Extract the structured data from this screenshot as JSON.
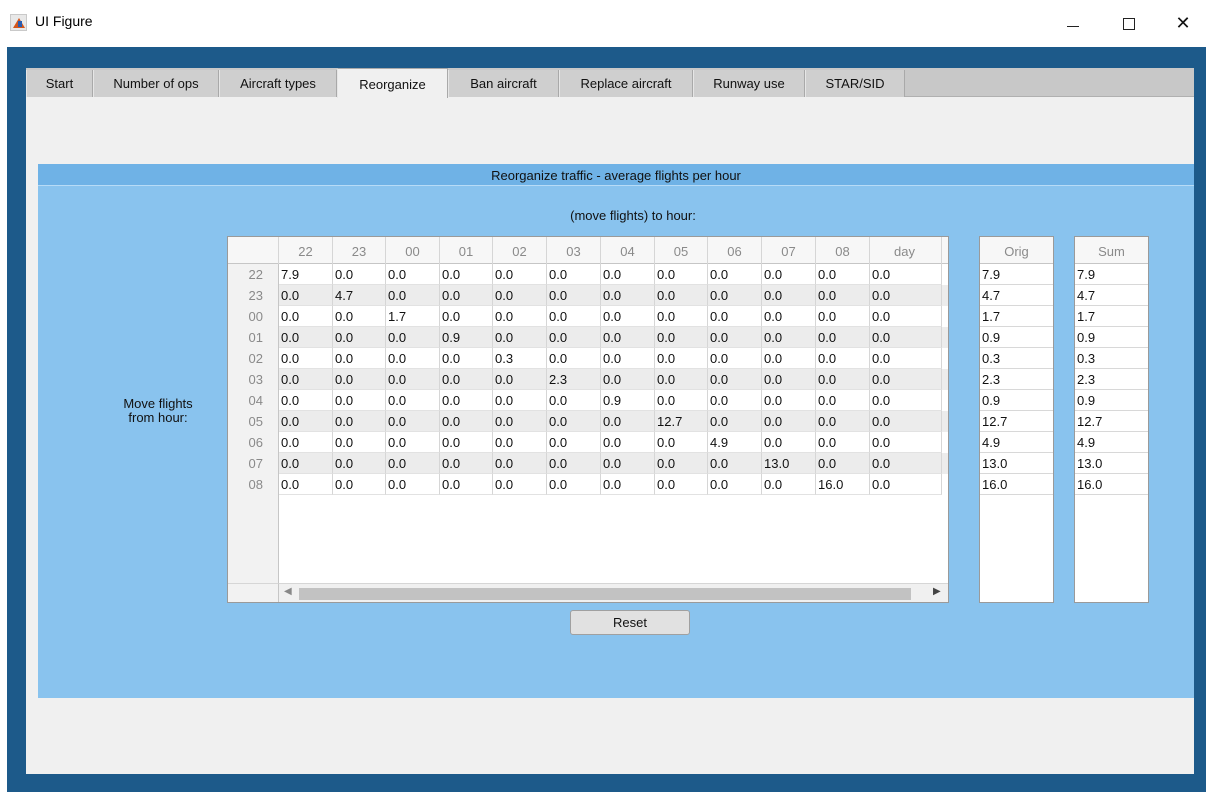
{
  "window": {
    "title": "UI Figure",
    "minimize_symbol": "—",
    "close_symbol": "✕"
  },
  "tabs": [
    {
      "label": "Start"
    },
    {
      "label": "Number of ops"
    },
    {
      "label": "Aircraft types"
    },
    {
      "label": "Reorganize",
      "active": true
    },
    {
      "label": "Ban aircraft"
    },
    {
      "label": "Replace aircraft"
    },
    {
      "label": "Runway use"
    },
    {
      "label": "STAR/SID"
    }
  ],
  "panel": {
    "title": "Reorganize traffic - average flights per hour",
    "subtitle": "(move flights) to hour:",
    "side_label_line1": "Move flights",
    "side_label_line2": "from hour:"
  },
  "table": {
    "columns": [
      "22",
      "23",
      "00",
      "01",
      "02",
      "03",
      "04",
      "05",
      "06",
      "07",
      "08",
      "day"
    ],
    "rows": [
      {
        "hour": "22",
        "values": [
          "7.9",
          "0.0",
          "0.0",
          "0.0",
          "0.0",
          "0.0",
          "0.0",
          "0.0",
          "0.0",
          "0.0",
          "0.0",
          "0.0"
        ]
      },
      {
        "hour": "23",
        "values": [
          "0.0",
          "4.7",
          "0.0",
          "0.0",
          "0.0",
          "0.0",
          "0.0",
          "0.0",
          "0.0",
          "0.0",
          "0.0",
          "0.0"
        ]
      },
      {
        "hour": "00",
        "values": [
          "0.0",
          "0.0",
          "1.7",
          "0.0",
          "0.0",
          "0.0",
          "0.0",
          "0.0",
          "0.0",
          "0.0",
          "0.0",
          "0.0"
        ]
      },
      {
        "hour": "01",
        "values": [
          "0.0",
          "0.0",
          "0.0",
          "0.9",
          "0.0",
          "0.0",
          "0.0",
          "0.0",
          "0.0",
          "0.0",
          "0.0",
          "0.0"
        ]
      },
      {
        "hour": "02",
        "values": [
          "0.0",
          "0.0",
          "0.0",
          "0.0",
          "0.3",
          "0.0",
          "0.0",
          "0.0",
          "0.0",
          "0.0",
          "0.0",
          "0.0"
        ]
      },
      {
        "hour": "03",
        "values": [
          "0.0",
          "0.0",
          "0.0",
          "0.0",
          "0.0",
          "2.3",
          "0.0",
          "0.0",
          "0.0",
          "0.0",
          "0.0",
          "0.0"
        ]
      },
      {
        "hour": "04",
        "values": [
          "0.0",
          "0.0",
          "0.0",
          "0.0",
          "0.0",
          "0.0",
          "0.9",
          "0.0",
          "0.0",
          "0.0",
          "0.0",
          "0.0"
        ]
      },
      {
        "hour": "05",
        "values": [
          "0.0",
          "0.0",
          "0.0",
          "0.0",
          "0.0",
          "0.0",
          "0.0",
          "12.7",
          "0.0",
          "0.0",
          "0.0",
          "0.0"
        ]
      },
      {
        "hour": "06",
        "values": [
          "0.0",
          "0.0",
          "0.0",
          "0.0",
          "0.0",
          "0.0",
          "0.0",
          "0.0",
          "4.9",
          "0.0",
          "0.0",
          "0.0"
        ]
      },
      {
        "hour": "07",
        "values": [
          "0.0",
          "0.0",
          "0.0",
          "0.0",
          "0.0",
          "0.0",
          "0.0",
          "0.0",
          "0.0",
          "13.0",
          "0.0",
          "0.0"
        ]
      },
      {
        "hour": "08",
        "values": [
          "0.0",
          "0.0",
          "0.0",
          "0.0",
          "0.0",
          "0.0",
          "0.0",
          "0.0",
          "0.0",
          "0.0",
          "16.0",
          "0.0"
        ]
      }
    ]
  },
  "orig": {
    "header": "Orig",
    "values": [
      "7.9",
      "4.7",
      "1.7",
      "0.9",
      "0.3",
      "2.3",
      "0.9",
      "12.7",
      "4.9",
      "13.0",
      "16.0"
    ]
  },
  "sum": {
    "header": "Sum",
    "values": [
      "7.9",
      "4.7",
      "1.7",
      "0.9",
      "0.3",
      "2.3",
      "0.9",
      "12.7",
      "4.9",
      "13.0",
      "16.0"
    ]
  },
  "reset_label": "Reset",
  "colors": {
    "frame": "#1d5a8a",
    "panel": "#89c3ee",
    "panel_title": "#6fb2e6"
  }
}
